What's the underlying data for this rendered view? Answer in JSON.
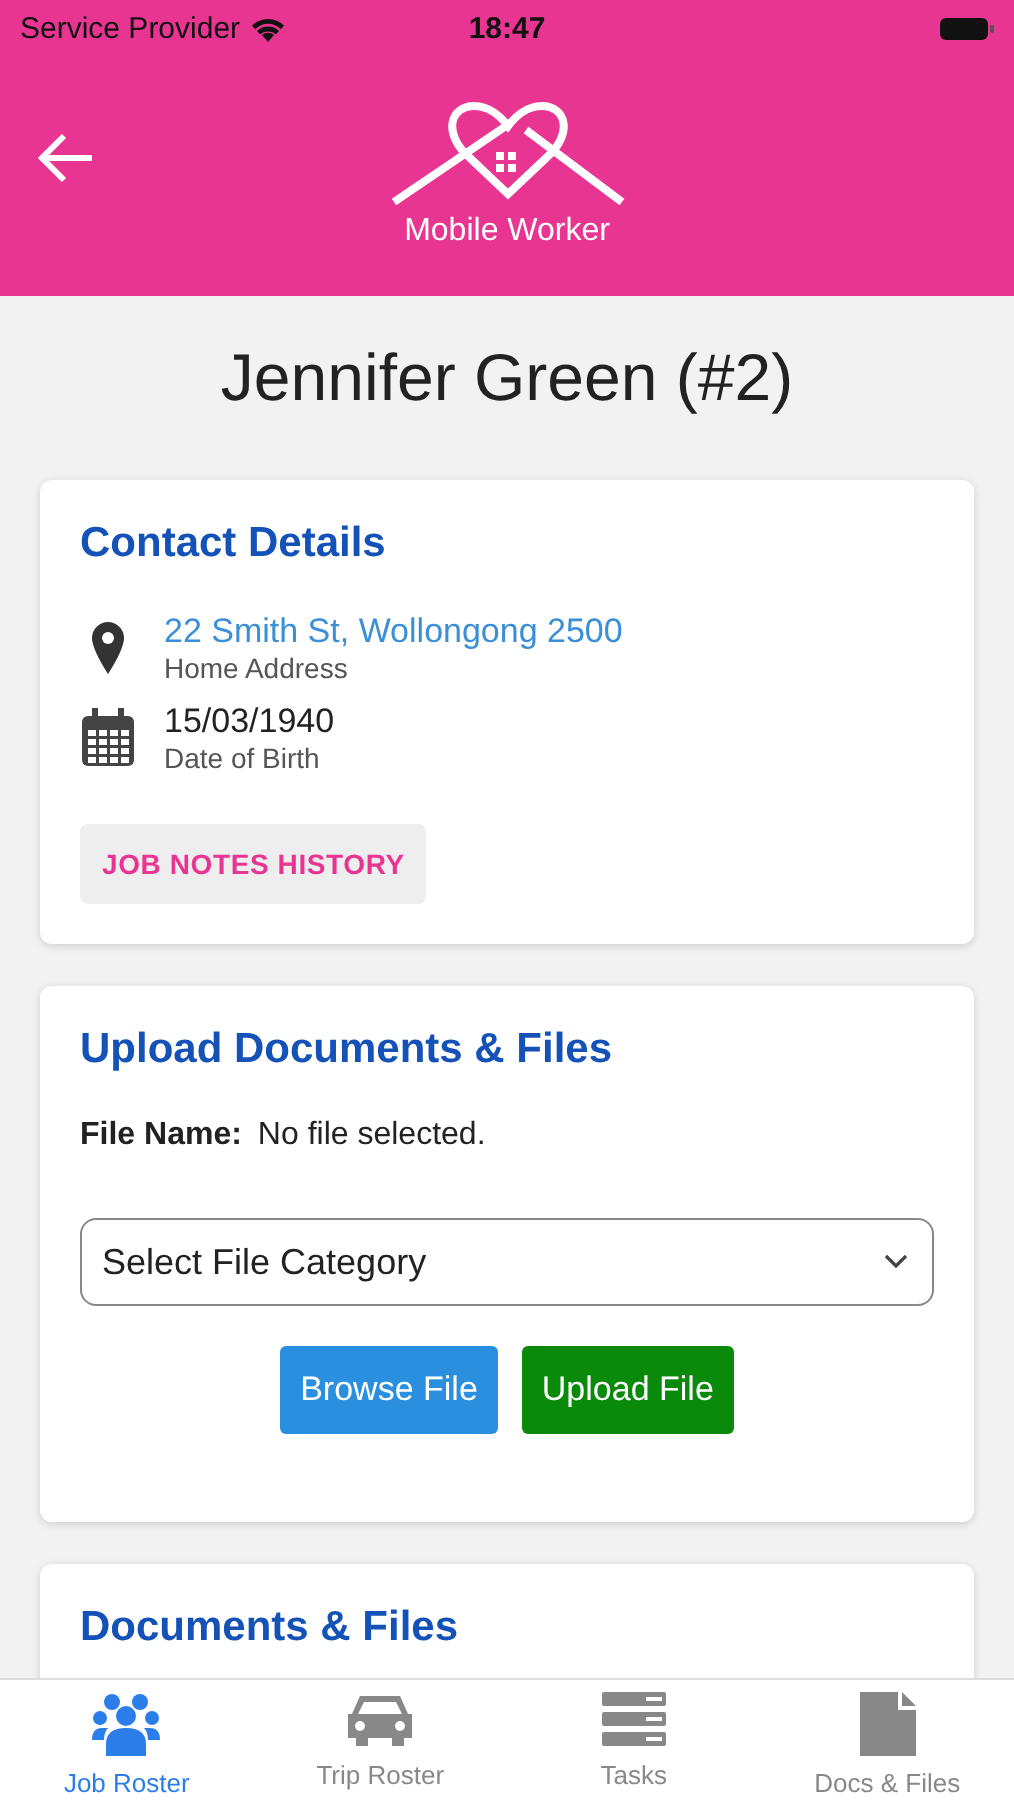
{
  "status_bar": {
    "carrier": "Service Provider",
    "time": "18:47"
  },
  "header": {
    "app_name": "Mobile Worker"
  },
  "title": "Jennifer Green (#2)",
  "contact": {
    "heading": "Contact Details",
    "items": [
      {
        "kind": "address",
        "value": "22 Smith St, Wollongong 2500",
        "label": "Home Address"
      },
      {
        "kind": "birth",
        "value": "15/03/1940",
        "label": "Date of Birth"
      }
    ],
    "button": "JOB NOTES HISTORY"
  },
  "upload": {
    "heading": "Upload Documents & Files",
    "file_label": "File Name:",
    "file_value": "No file selected.",
    "category": {
      "value": "Select File Category"
    },
    "buttons": [
      {
        "kind": "browse",
        "label": "Browse File"
      },
      {
        "kind": "upload",
        "label": "Upload File"
      }
    ]
  },
  "documents": {
    "heading": "Documents & Files"
  },
  "tabs": [
    {
      "kind": "people",
      "label": "Job Roster",
      "selected": true
    },
    {
      "kind": "car",
      "label": "Trip Roster",
      "selected": false
    },
    {
      "kind": "tasks",
      "label": "Tasks",
      "selected": false
    },
    {
      "kind": "file",
      "label": "Docs & Files",
      "selected": false
    }
  ]
}
